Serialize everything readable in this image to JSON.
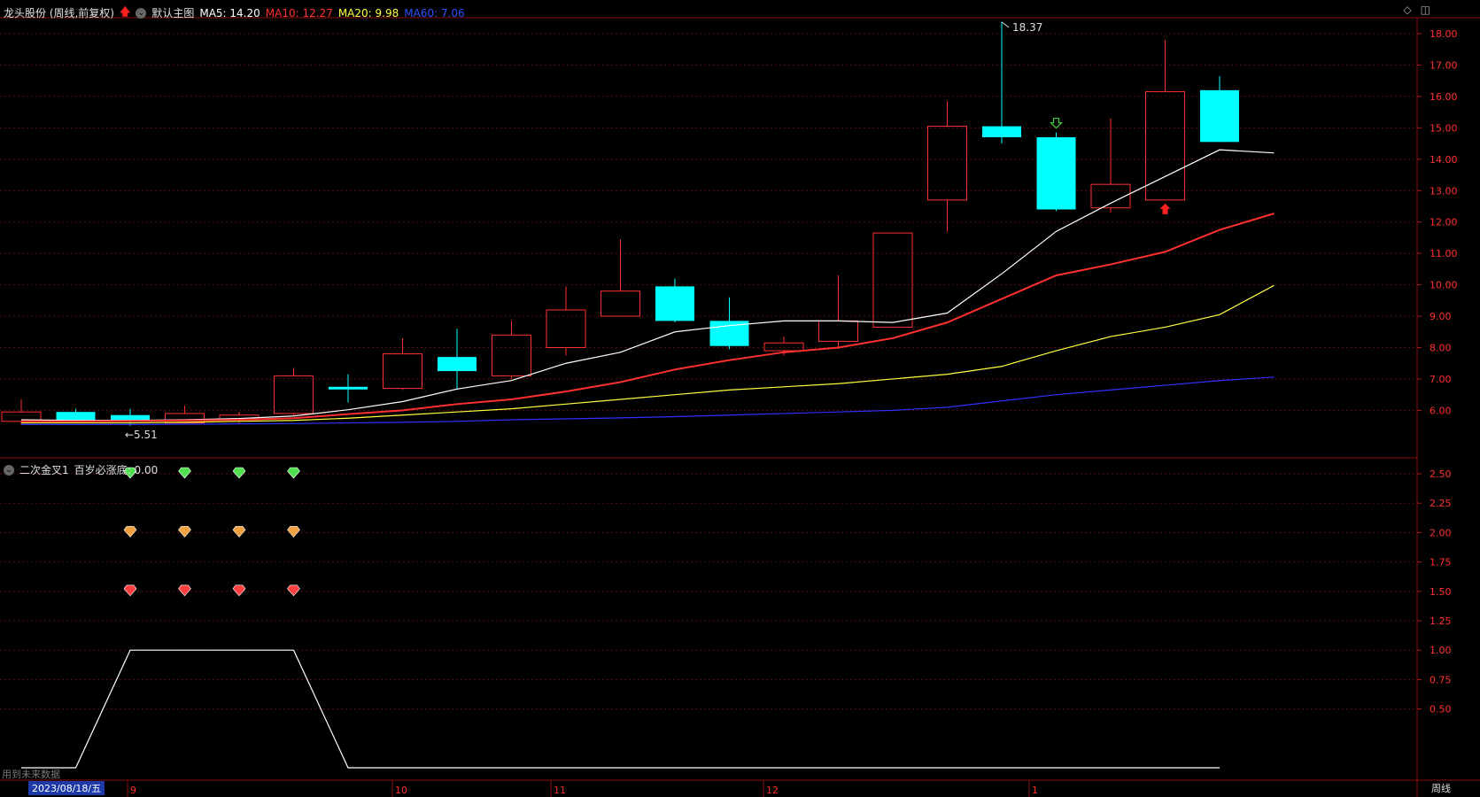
{
  "header": {
    "stock_title": "龙头股份 (周线,前复权)",
    "chart_mode": "默认主图",
    "ma5": "MA5: 14.20",
    "ma10": "MA10: 12.27",
    "ma20": "MA20: 9.98",
    "ma60": "MA60: 7.06",
    "colors": {
      "ma5": "#ffffff",
      "ma10": "#ff3030",
      "ma20": "#ffff40",
      "ma60": "#3030ff"
    }
  },
  "indicator": {
    "title": "二次金叉1",
    "value_label": "百岁必涨底: 0.00"
  },
  "footer": {
    "future_data_note": "用到未来数据",
    "cursor_date": "2023/08/18/五",
    "period_button": "周线",
    "month_labels": [
      "9",
      "10",
      "11",
      "12",
      "1"
    ]
  },
  "chart_data": [
    {
      "type": "candlestick",
      "title": "",
      "price_axis_ticks": [
        "18.00",
        "17.00",
        "16.00",
        "15.00",
        "14.00",
        "13.00",
        "12.00",
        "11.00",
        "10.00",
        "9.00",
        "8.00",
        "7.00",
        "6.00"
      ],
      "ylim": [
        5.4,
        18.5
      ],
      "annotations": [
        {
          "text": "18.37",
          "at_candle": 18
        },
        {
          "text": "5.51",
          "at_candle": 2
        }
      ],
      "candles": [
        {
          "o": 5.95,
          "h": 6.35,
          "l": 5.55,
          "c": 5.65,
          "up": true
        },
        {
          "o": 5.95,
          "h": 6.05,
          "l": 5.6,
          "c": 5.65,
          "up": false
        },
        {
          "o": 5.85,
          "h": 6.05,
          "l": 5.51,
          "c": 5.7,
          "up": false
        },
        {
          "o": 5.6,
          "h": 6.15,
          "l": 5.6,
          "c": 5.9,
          "up": true
        },
        {
          "o": 5.7,
          "h": 5.95,
          "l": 5.6,
          "c": 5.85,
          "up": true
        },
        {
          "o": 5.9,
          "h": 7.35,
          "l": 5.85,
          "c": 7.1,
          "up": true
        },
        {
          "o": 6.75,
          "h": 7.15,
          "l": 6.25,
          "c": 6.7,
          "up": false
        },
        {
          "o": 6.7,
          "h": 8.3,
          "l": 6.65,
          "c": 7.8,
          "up": true
        },
        {
          "o": 7.7,
          "h": 8.6,
          "l": 6.65,
          "c": 7.25,
          "up": false
        },
        {
          "o": 7.1,
          "h": 8.85,
          "l": 7.0,
          "c": 8.4,
          "up": true
        },
        {
          "o": 8.0,
          "h": 9.95,
          "l": 7.75,
          "c": 9.2,
          "up": true
        },
        {
          "o": 9.0,
          "h": 11.45,
          "l": 9.0,
          "c": 9.8,
          "up": true
        },
        {
          "o": 9.95,
          "h": 10.2,
          "l": 8.8,
          "c": 8.85,
          "up": false
        },
        {
          "o": 8.85,
          "h": 9.6,
          "l": 7.95,
          "c": 8.05,
          "up": false
        },
        {
          "o": 7.9,
          "h": 8.35,
          "l": 7.75,
          "c": 8.15,
          "up": true
        },
        {
          "o": 8.2,
          "h": 10.3,
          "l": 7.95,
          "c": 8.85,
          "up": true
        },
        {
          "o": 8.65,
          "h": 11.65,
          "l": 8.65,
          "c": 11.65,
          "up": true
        },
        {
          "o": 12.7,
          "h": 15.85,
          "l": 11.7,
          "c": 15.05,
          "up": true
        },
        {
          "o": 15.05,
          "h": 18.37,
          "l": 14.5,
          "c": 14.7,
          "up": false
        },
        {
          "o": 14.7,
          "h": 14.85,
          "l": 12.35,
          "c": 12.4,
          "up": false
        },
        {
          "o": 12.45,
          "h": 15.3,
          "l": 12.3,
          "c": 13.2,
          "up": true
        },
        {
          "o": 12.7,
          "h": 17.8,
          "l": 12.7,
          "c": 16.15,
          "up": true
        },
        {
          "o": 16.2,
          "h": 16.65,
          "l": 14.55,
          "c": 14.55,
          "up": false
        }
      ],
      "series": [
        {
          "name": "MA5",
          "color": "#ffffff",
          "values": [
            5.7,
            5.68,
            5.68,
            5.7,
            5.74,
            5.82,
            6.02,
            6.28,
            6.68,
            6.95,
            7.5,
            7.85,
            8.5,
            8.7,
            8.85,
            8.85,
            8.8,
            9.1,
            10.35,
            11.7,
            12.6,
            13.45,
            14.3,
            14.2
          ]
        },
        {
          "name": "MA10",
          "color": "#ff3030",
          "values": [
            5.65,
            5.65,
            5.66,
            5.68,
            5.7,
            5.75,
            5.88,
            6.0,
            6.2,
            6.35,
            6.6,
            6.9,
            7.3,
            7.6,
            7.85,
            8.0,
            8.3,
            8.8,
            9.55,
            10.3,
            10.65,
            11.05,
            11.75,
            12.27
          ]
        },
        {
          "name": "MA20",
          "color": "#ffff40",
          "values": [
            5.6,
            5.6,
            5.6,
            5.62,
            5.65,
            5.68,
            5.75,
            5.85,
            5.95,
            6.05,
            6.2,
            6.35,
            6.5,
            6.65,
            6.75,
            6.85,
            7.0,
            7.15,
            7.4,
            7.9,
            8.35,
            8.65,
            9.05,
            9.98
          ]
        },
        {
          "name": "MA60",
          "color": "#3030ff",
          "values": [
            5.55,
            5.55,
            5.55,
            5.56,
            5.57,
            5.58,
            5.6,
            5.62,
            5.65,
            5.7,
            5.73,
            5.76,
            5.8,
            5.85,
            5.9,
            5.95,
            6.0,
            6.1,
            6.3,
            6.5,
            6.65,
            6.8,
            6.95,
            7.06
          ]
        }
      ],
      "signals": [
        {
          "candle": 19,
          "kind": "down-arrow",
          "color": "#40d040"
        },
        {
          "candle": 21,
          "kind": "up-arrow",
          "color": "#ff2020"
        }
      ]
    },
    {
      "type": "line",
      "title": "",
      "y_axis_ticks": [
        "2.50",
        "2.25",
        "2.00",
        "1.75",
        "1.50",
        "1.25",
        "1.00",
        "0.75",
        "0.50"
      ],
      "ylim": [
        0,
        2.6
      ],
      "series": [
        {
          "color": "#ffffff",
          "x": [
            0,
            1,
            2,
            3,
            4,
            5,
            6,
            7,
            8,
            9,
            10,
            11,
            12,
            13,
            14,
            15,
            16,
            17,
            18,
            19,
            20,
            21,
            22
          ],
          "values": [
            0,
            0,
            1,
            1,
            1,
            1,
            0,
            0,
            0,
            0,
            0,
            0,
            0,
            0,
            0,
            0,
            0,
            0,
            0,
            0,
            0,
            0,
            0
          ]
        }
      ],
      "gem_rows": [
        {
          "level": 2.5,
          "color": "#50e050",
          "candles": [
            2,
            3,
            4,
            5
          ]
        },
        {
          "level": 2.0,
          "color": "#f0a040",
          "candles": [
            2,
            3,
            4,
            5
          ]
        },
        {
          "level": 1.5,
          "color": "#ff4040",
          "candles": [
            2,
            3,
            4,
            5
          ]
        }
      ]
    }
  ]
}
